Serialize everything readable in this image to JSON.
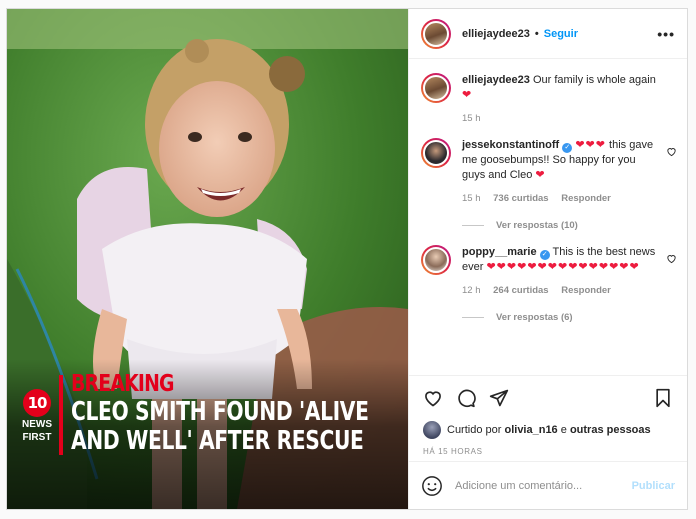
{
  "photo": {
    "breaking": "BREAKING",
    "headline_line1": "CLEO SMITH FOUND 'ALIVE",
    "headline_line2": "AND WELL' AFTER RESCUE",
    "logo_number": "10",
    "logo_news": "NEWS",
    "logo_first": "FIRST"
  },
  "header": {
    "username": "elliejaydee23",
    "separator": "•",
    "follow_label": "Seguir",
    "more_icon": "more-horizontal-icon"
  },
  "caption": {
    "username": "elliejaydee23",
    "text": "Our family is whole again",
    "hearts": "❤",
    "time": "15 h"
  },
  "comments": [
    {
      "username": "jessekonstantinoff",
      "verified": true,
      "hearts_before": "❤❤❤",
      "text": "this gave me goosebumps!! So happy for you guys and Cleo",
      "hearts_after": "❤",
      "time": "15 h",
      "likes": "736 curtidas",
      "reply_label": "Responder",
      "view_replies": "Ver respostas (10)"
    },
    {
      "username": "poppy__marie",
      "verified": true,
      "text": "This is the best news ever",
      "hearts_after": "❤❤❤❤❤❤❤❤❤❤❤❤❤❤❤",
      "time": "12 h",
      "likes": "264 curtidas",
      "reply_label": "Responder",
      "view_replies": "Ver respostas (6)"
    }
  ],
  "likes": {
    "prefix": "Curtido por",
    "user": "olivia_n16",
    "joiner": "e",
    "others": "outras pessoas"
  },
  "timestamp": "HÁ 15 HORAS",
  "add_comment": {
    "placeholder": "Adicione um comentário...",
    "publish_label": "Publicar"
  },
  "colors": {
    "accent": "#0095f6",
    "heart": "#ed1c3f",
    "breaking_red": "#e3001b"
  }
}
